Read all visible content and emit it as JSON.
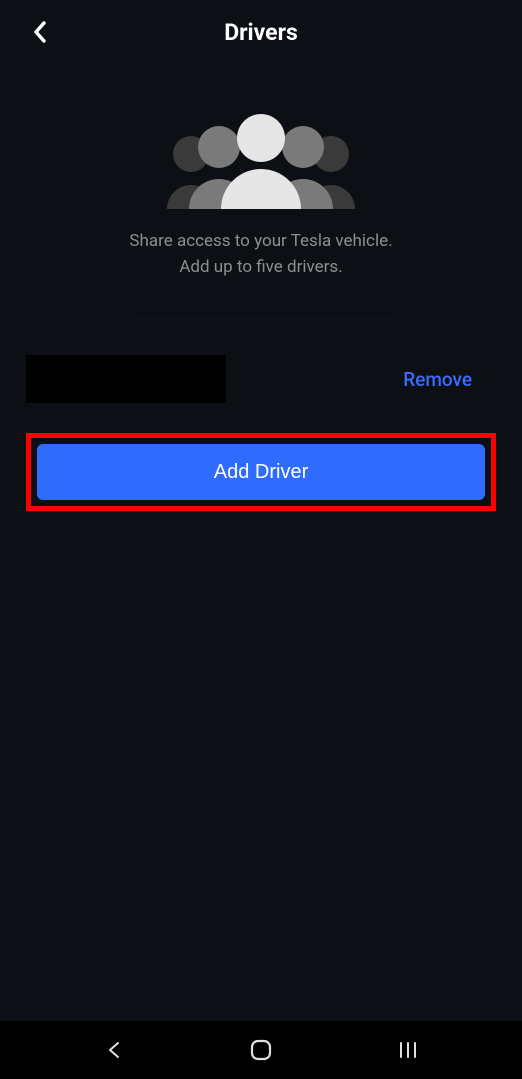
{
  "header": {
    "title": "Drivers"
  },
  "hero": {
    "line1": "Share access to your Tesla vehicle.",
    "line2": "Add up to five drivers."
  },
  "driver_row": {
    "name_redacted": true,
    "remove_label": "Remove"
  },
  "actions": {
    "add_driver_label": "Add Driver"
  },
  "colors": {
    "accent": "#2f6bff",
    "highlight": "#ff0000",
    "bg": "#0c0f14",
    "muted": "#8e8e8e"
  }
}
